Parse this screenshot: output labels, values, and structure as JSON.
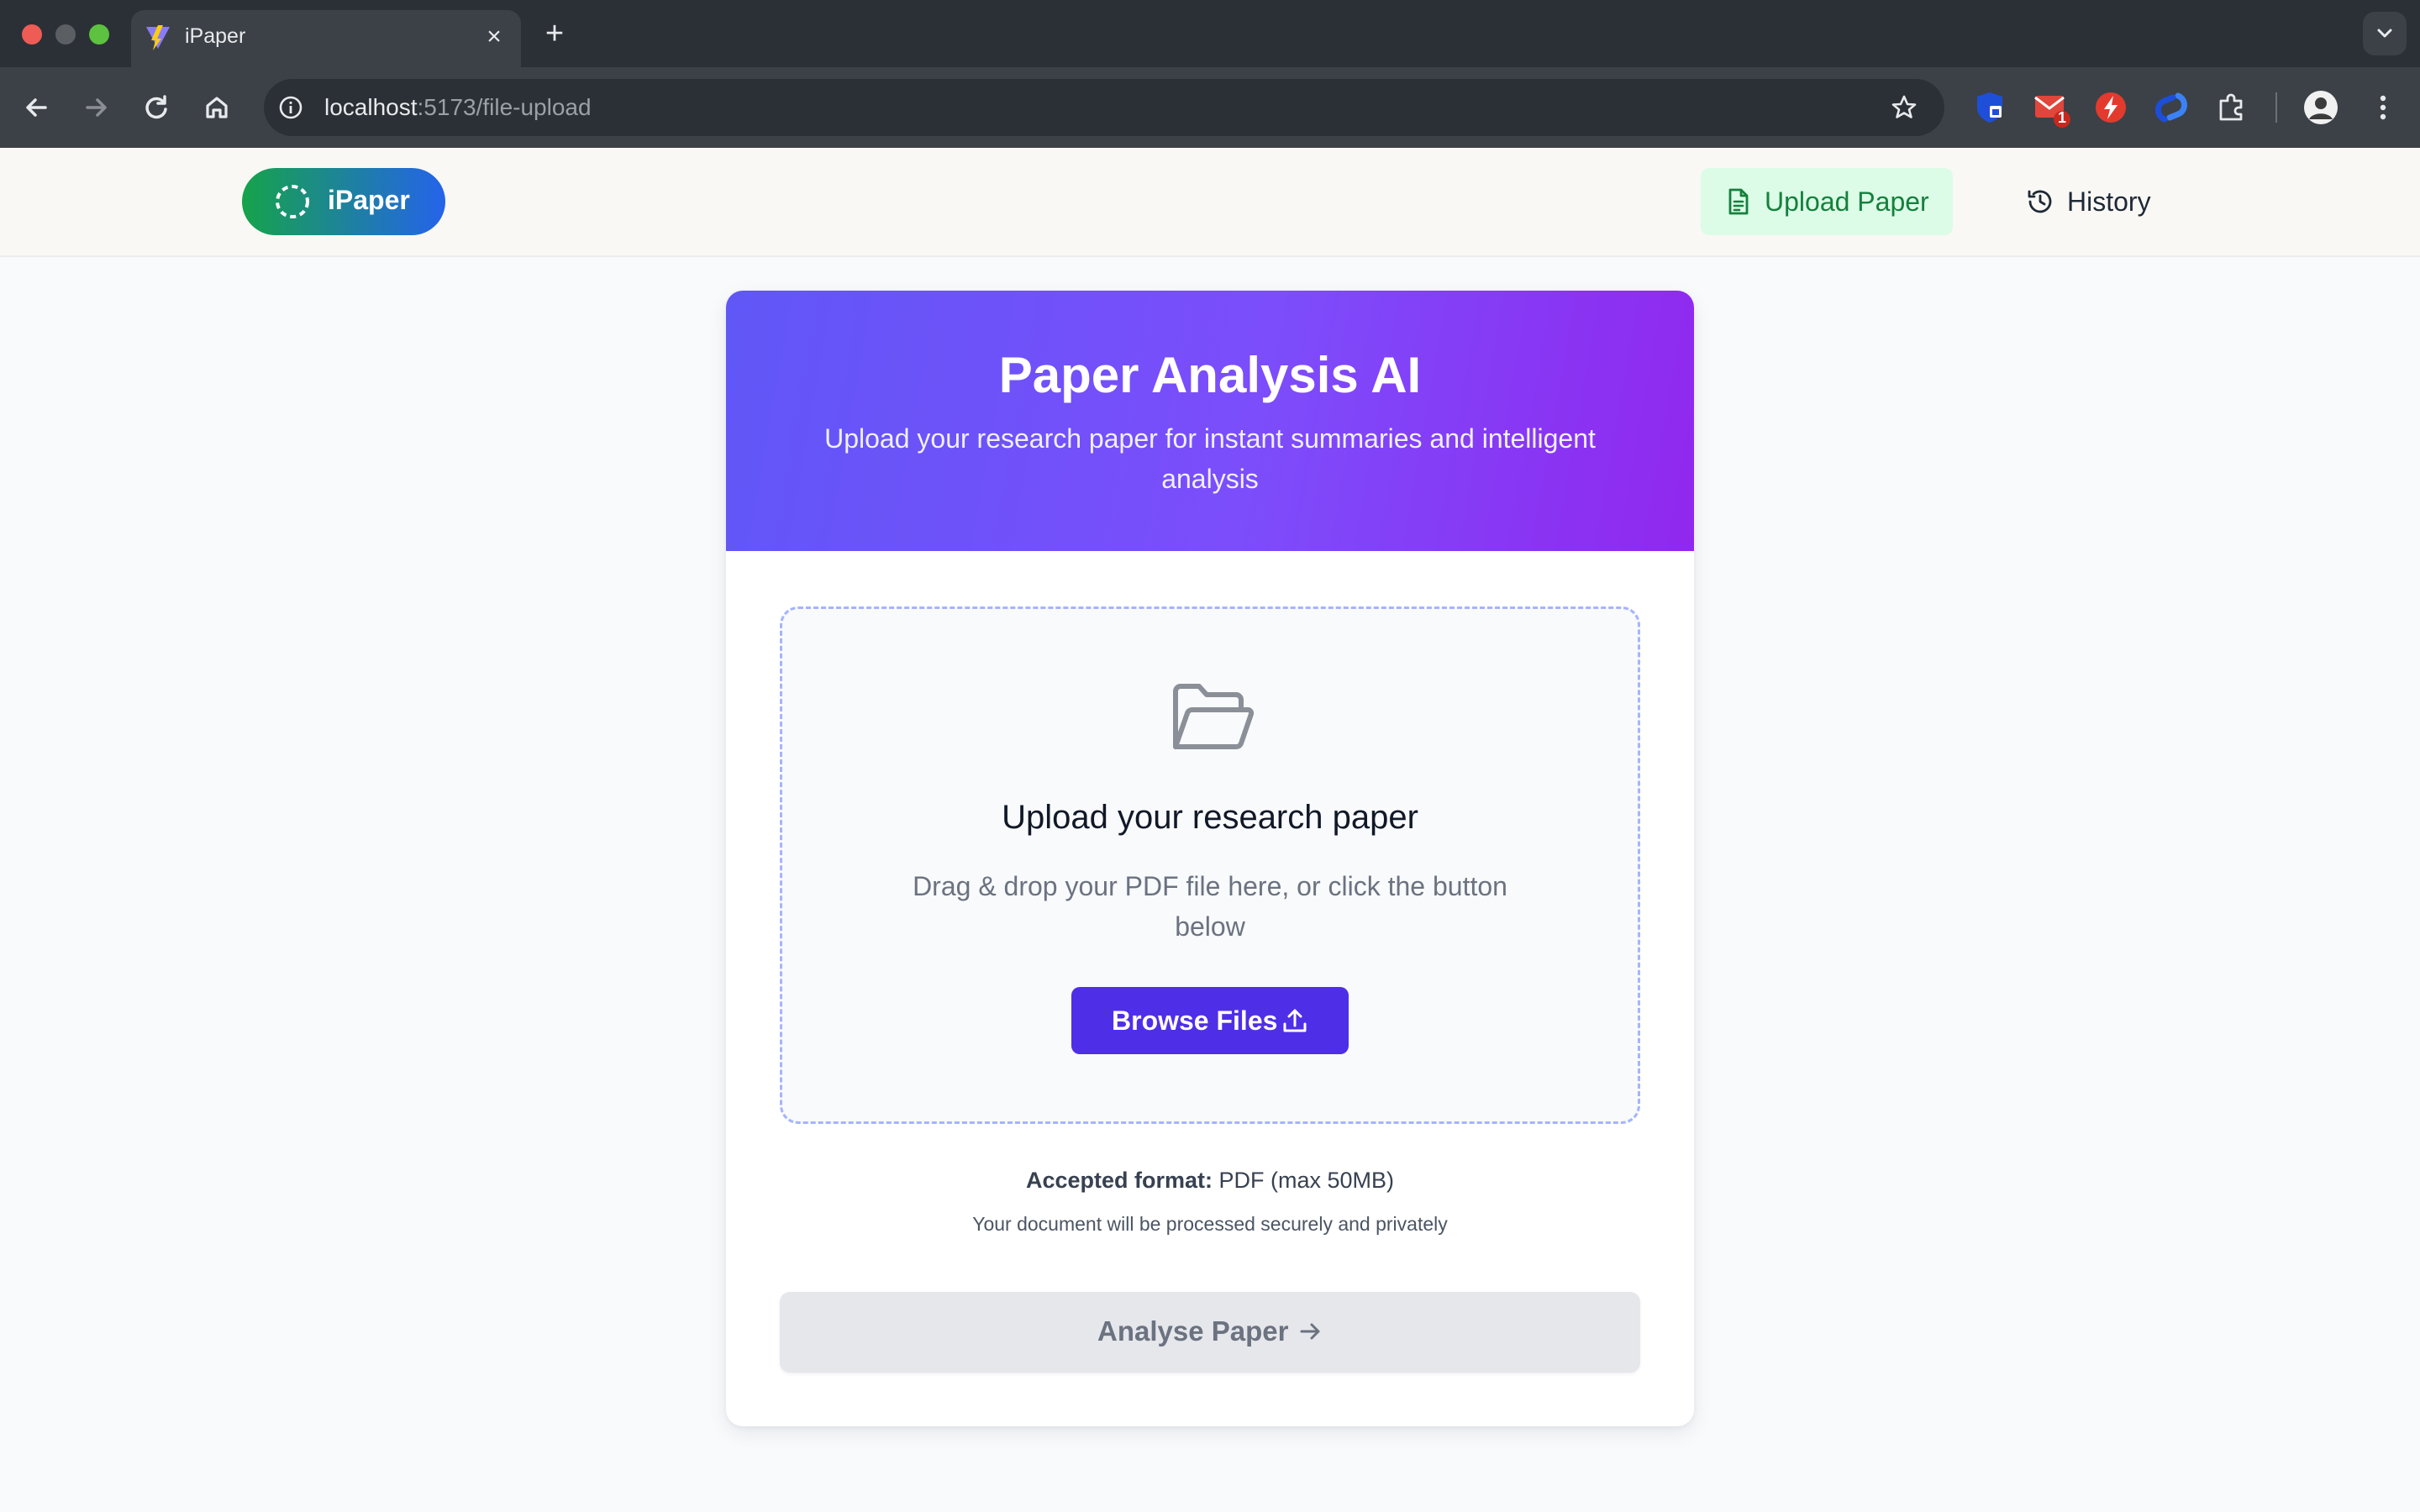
{
  "browser": {
    "tab_title": "iPaper",
    "new_tab_label": "+",
    "close_tab_label": "×",
    "url_host": "localhost",
    "url_path": ":5173/file-upload",
    "extension_badge": "1"
  },
  "navbar": {
    "logo_text": "iPaper",
    "upload_label": "Upload Paper",
    "history_label": "History"
  },
  "hero": {
    "title": "Paper Analysis AI",
    "subtitle": "Upload your research paper for instant summaries and intelligent analysis"
  },
  "dropzone": {
    "title": "Upload your research paper",
    "description": "Drag & drop your PDF file here, or click the button below",
    "browse_label": "Browse Files"
  },
  "info": {
    "accepted_label": "Accepted format:",
    "accepted_value": "PDF (max 50MB)",
    "secure_note": "Your document will be processed securely and privately"
  },
  "actions": {
    "analyse_label": "Analyse Paper"
  },
  "colors": {
    "header_gradient_start": "#6057f7",
    "header_gradient_end": "#9127ee",
    "browse_button": "#4f2ee8",
    "upload_nav_bg": "#dcfce7",
    "upload_nav_text": "#15803d"
  }
}
